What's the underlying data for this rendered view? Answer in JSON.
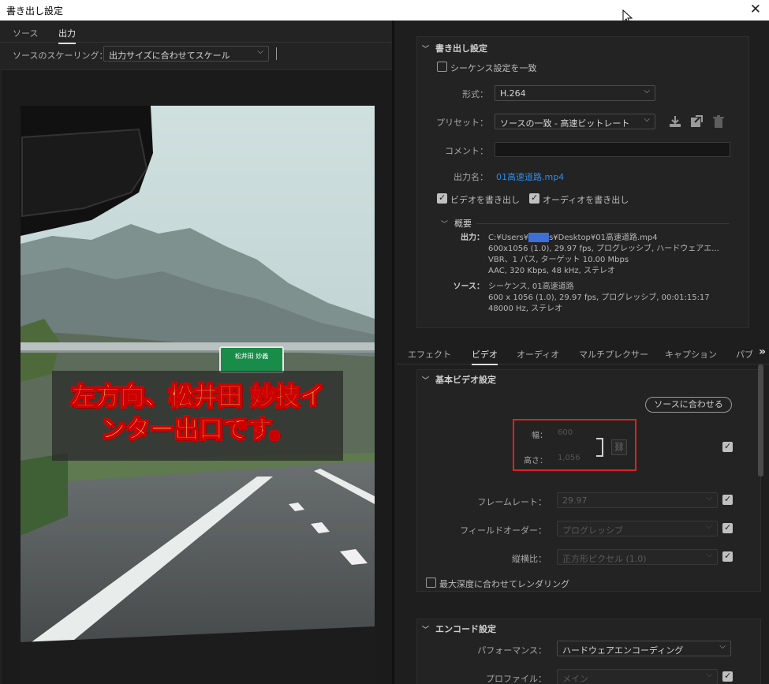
{
  "window": {
    "title": "書き出し設定",
    "close_glyph": "✕"
  },
  "left_tabs": [
    {
      "label": "ソース"
    },
    {
      "label": "出力"
    }
  ],
  "scaling": {
    "label": "ソースのスケーリング：",
    "value": "出力サイズに合わせてスケール"
  },
  "preview": {
    "caption": "左方向、松井田 妙技イ\nンター出口です。",
    "sign_text": "松井田  妙義"
  },
  "export_settings": {
    "header": "書き出し設定",
    "match_sequence_label": "シーケンス設定を一致",
    "match_sequence_checked": false,
    "format_label": "形式：",
    "format_value": "H.264",
    "preset_label": "プリセット：",
    "preset_value": "ソースの一致 - 高速ビットレート",
    "comment_label": "コメント：",
    "comment_value": "",
    "output_name_label": "出力名：",
    "output_name_value": "01高速道路.mp4",
    "export_video_label": "ビデオを書き出し",
    "export_video_checked": true,
    "export_audio_label": "オーディオを書き出し",
    "export_audio_checked": true,
    "summary_header": "概要",
    "summary": {
      "output_key": "出力：",
      "output_path_pre": "C:¥Users¥",
      "output_path_post": "s¥Desktop¥01高速道路.mp4",
      "output_line2": "600x1056 (1.0), 29.97 fps, プログレッシブ, ハードウェアエ...",
      "output_line3": "VBR、1 パス, ターゲット 10.00 Mbps",
      "output_line4": "AAC, 320 Kbps, 48 kHz, ステレオ",
      "source_key": "ソース：",
      "source_line1": "シーケンス, 01高速道路",
      "source_line2": "600 x 1056 (1.0), 29.97 fps, プログレッシブ, 00:01:15:17",
      "source_line3": "48000  Hz, ステレオ"
    }
  },
  "right_tabs": [
    {
      "label": "エフェクト"
    },
    {
      "label": "ビデオ"
    },
    {
      "label": "オーディオ"
    },
    {
      "label": "マルチプレクサー"
    },
    {
      "label": "キャプション"
    },
    {
      "label": "パブ"
    }
  ],
  "more_glyph": "»",
  "basic_video": {
    "header": "基本ビデオ設定",
    "match_source_button": "ソースに合わせる",
    "width_label": "幅：",
    "width_value": "600",
    "height_label": "高さ：",
    "height_value": "1,056",
    "framerate_label": "フレームレート：",
    "framerate_value": "29.97",
    "field_order_label": "フィールドオーダー：",
    "field_order_value": "プログレッシブ",
    "aspect_label": "縦横比：",
    "aspect_value": "正方形ピクセル (1.0)",
    "max_depth_label": "最大深度に合わせてレンダリング",
    "max_depth_checked": false
  },
  "encode": {
    "header": "エンコード設定",
    "performance_label": "パフォーマンス：",
    "performance_value": "ハードウェアエンコーディング",
    "profile_label": "プロファイル：",
    "profile_value": "メイン"
  },
  "colors": {
    "accent_link": "#2d8ceb",
    "highlight_box": "#e02020"
  }
}
